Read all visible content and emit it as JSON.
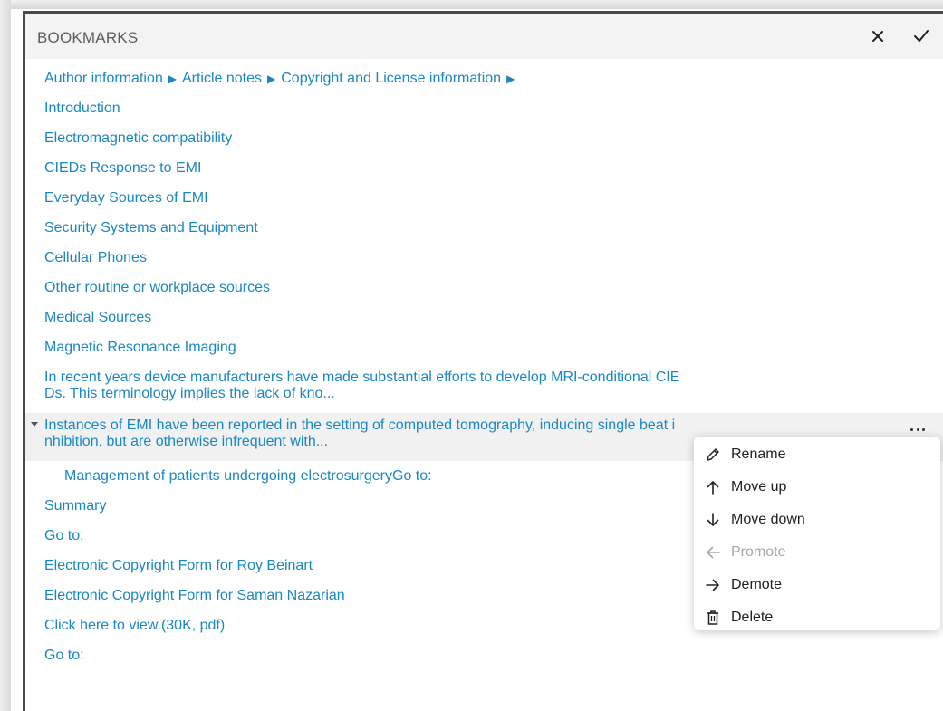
{
  "panel": {
    "title": "BOOKMARKS"
  },
  "breadcrumb": {
    "items": [
      "Author information",
      "Article notes",
      "Copyright and License information"
    ],
    "separator": "▶"
  },
  "bookmarks": [
    "Introduction",
    "Electromagnetic compatibility",
    "CIEDs Response to EMI",
    "Everyday Sources of EMI",
    "Security Systems and Equipment",
    "Cellular Phones",
    "Other routine or workplace sources",
    "Medical Sources",
    "Magnetic Resonance Imaging"
  ],
  "long_bookmark": {
    "line1": "In recent years device manufacturers have made substantial efforts to develop MRI-conditional CIE",
    "line2": "Ds. This terminology implies the lack of kno..."
  },
  "selected_bookmark": {
    "line1": "Instances of EMI have been reported in the setting of computed tomography, inducing single beat i",
    "line2": "nhibition, but are otherwise infrequent with..."
  },
  "child_bookmark": "Management of patients undergoing electrosurgeryGo to:",
  "lower_bookmarks": [
    "Summary",
    "Go to:",
    "Electronic Copyright Form for Roy Beinart",
    "Electronic Copyright Form for Saman Nazarian",
    "Click here to view.(30K, pdf)",
    "Go to:"
  ],
  "context_menu": {
    "items": [
      {
        "label": "Rename",
        "icon": "pencil-icon",
        "enabled": true
      },
      {
        "label": "Move up",
        "icon": "arrow-up-icon",
        "enabled": true
      },
      {
        "label": "Move down",
        "icon": "arrow-down-icon",
        "enabled": true
      },
      {
        "label": "Promote",
        "icon": "arrow-left-icon",
        "enabled": false
      },
      {
        "label": "Demote",
        "icon": "arrow-right-icon",
        "enabled": true
      },
      {
        "label": "Delete",
        "icon": "trash-icon",
        "enabled": true
      }
    ]
  },
  "colors": {
    "link": "#1a87c2",
    "header_bg": "#f3f3f3",
    "selected_bg": "#f1f1f1",
    "disabled": "#a8a8a8"
  }
}
